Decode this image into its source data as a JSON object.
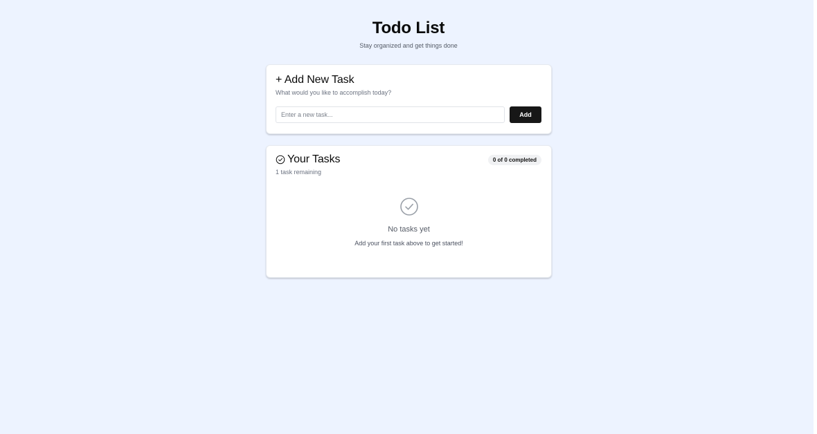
{
  "header": {
    "title": "Todo List",
    "subtitle": "Stay organized and get things done"
  },
  "add_task_card": {
    "title": "+ Add New Task",
    "description": "What would you like to accomplish today?",
    "input_placeholder": "Enter a new task...",
    "input_value": "",
    "add_button_label": "Add"
  },
  "tasks_card": {
    "title_icon": "check-circle-icon",
    "title": "Your Tasks",
    "remaining": "1 task remaining",
    "completed_badge": "0 of 0 completed",
    "empty_state": {
      "icon": "check-circle-icon",
      "title": "No tasks yet",
      "description": "Add your first task above to get started!"
    }
  },
  "colors": {
    "background": "#edf3ff",
    "card": "#ffffff",
    "primary_button": "#171717",
    "badge_bg": "#f0f1f3",
    "muted_text": "#6b7280",
    "empty_icon": "#9aa0a8"
  }
}
